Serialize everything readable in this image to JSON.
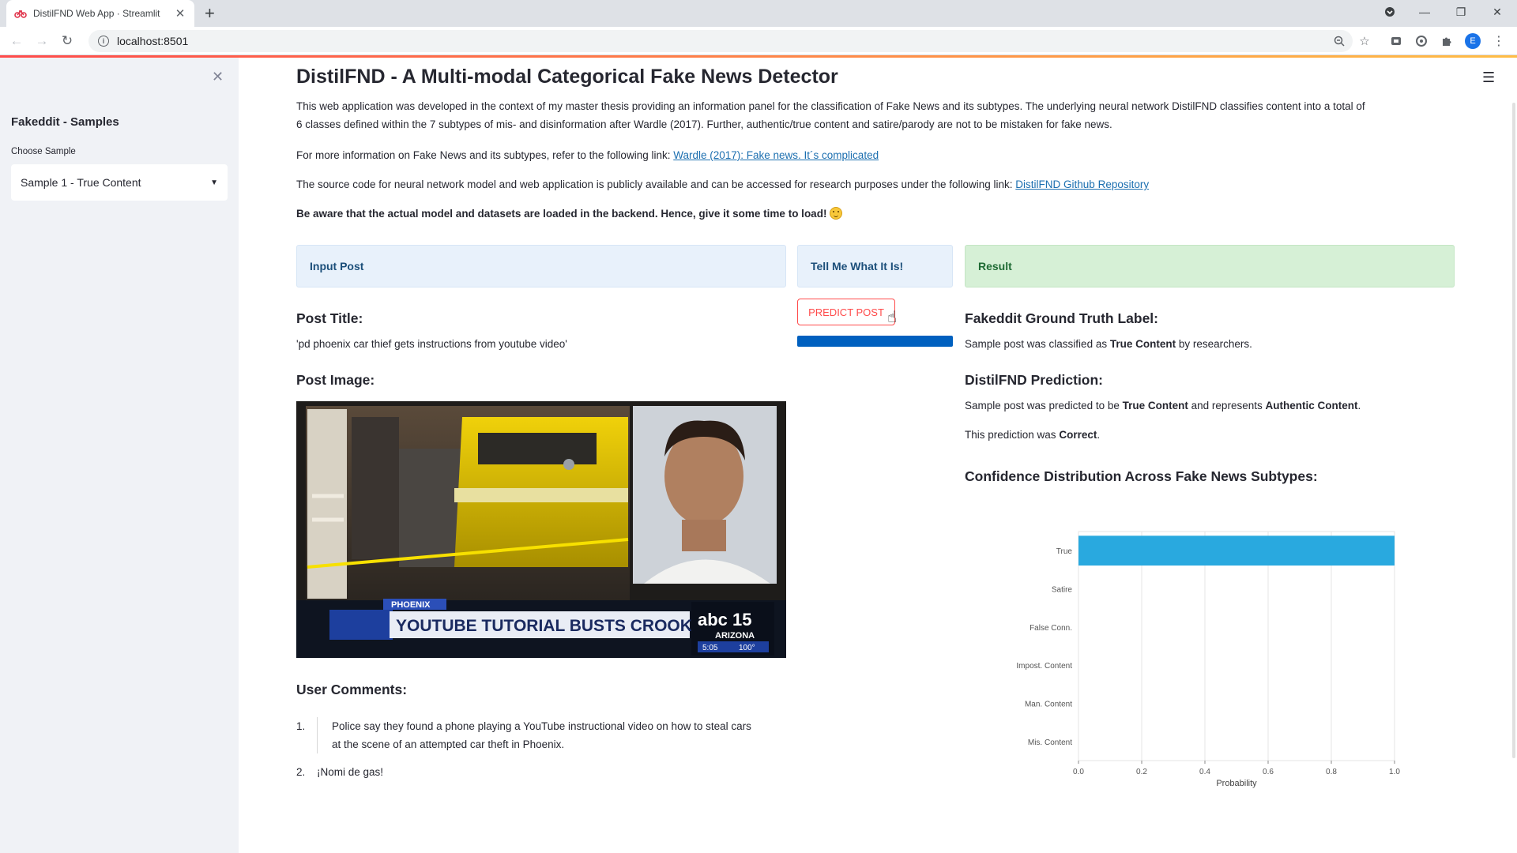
{
  "browser": {
    "tab_title": "DistilFND Web App · Streamlit",
    "url": "localhost:8501",
    "profile_initial": "E"
  },
  "sidebar": {
    "title": "Fakeddit - Samples",
    "select_label": "Choose Sample",
    "select_value": "Sample 1 - True Content"
  },
  "main": {
    "title": "DistilFND - A Multi-modal Categorical Fake News Detector",
    "intro_line1": "This web application was developed in the context of my master thesis providing an information panel for the classification of Fake News and its subtypes. The underlying neural network DistilFND classifies content into a total of",
    "intro_line2": "6 classes defined within the 7 subtypes of mis- and disinformation after Wardle (2017). Further, authentic/true content and satire/parody are not to be mistaken for fake news.",
    "more_info_text": "For more information on Fake News and its subtypes, refer to the following link:",
    "more_info_link": "Wardle (2017): Fake news. It´s complicated",
    "source_text": "The source code for neural network model and web application is publicly available and can be accessed for research purposes under the following link:",
    "source_link": "DistilFND Github Repository",
    "warning": "Be aware that the actual model and datasets are loaded in the backend. Hence, give it some time to load!"
  },
  "columns": {
    "input_header": "Input Post",
    "tell_header": "Tell Me What It Is!",
    "result_header": "Result"
  },
  "post": {
    "title_heading": "Post Title:",
    "title_value": "'pd phoenix car thief gets instructions from youtube video'",
    "image_heading": "Post Image:",
    "image_caption_top": "PHOENIX",
    "image_caption_main": "YOUTUBE TUTORIAL BUSTS CROOK",
    "image_station": "abc 15",
    "image_station_sub": "ARIZONA",
    "image_time": "5:05",
    "image_temp": "100°",
    "comments_heading": "User Comments:",
    "comments": [
      {
        "num": "1.",
        "line1": "Police say they found a phone playing a YouTube instructional video on how to steal cars",
        "line2": "at the scene of an attempted car theft in Phoenix."
      },
      {
        "num": "2.",
        "line1": "¡Nomi de gas!",
        "line2": ""
      }
    ]
  },
  "predict": {
    "button_label": "PREDICT POST",
    "progress": 1.0
  },
  "result": {
    "gt_heading": "Fakeddit Ground Truth Label:",
    "gt_prefix": "Sample post was classified as",
    "gt_label": "True Content",
    "gt_suffix": "by researchers.",
    "pred_heading": "DistilFND Prediction:",
    "pred_prefix": "Sample post was predicted to be",
    "pred_label": "True Content",
    "pred_mid": "and represents",
    "pred_class": "Authentic Content",
    "pred_end": ".",
    "correct_prefix": "This prediction was",
    "correct_value": "Correct",
    "correct_end": ".",
    "chart_heading": "Confidence Distribution Across Fake News Subtypes:"
  },
  "chart_data": {
    "type": "bar",
    "orientation": "horizontal",
    "categories": [
      "True",
      "Satire",
      "False Conn.",
      "Impost. Content",
      "Man. Content",
      "Mis. Content"
    ],
    "values": [
      1.0,
      0.0,
      0.0,
      0.0,
      0.0,
      0.0
    ],
    "xlabel": "Probability",
    "ylabel": "",
    "xlim": [
      0,
      1
    ],
    "xticks": [
      "0.0",
      "0.2",
      "0.4",
      "0.6",
      "0.8",
      "1.0"
    ],
    "grid": true,
    "bar_color": "#29a9df"
  },
  "colors": {
    "accent": "#ff4b4b",
    "progress": "#0060bf",
    "info_bg": "#e8f1fb",
    "success_bg": "#d6f0d6"
  }
}
